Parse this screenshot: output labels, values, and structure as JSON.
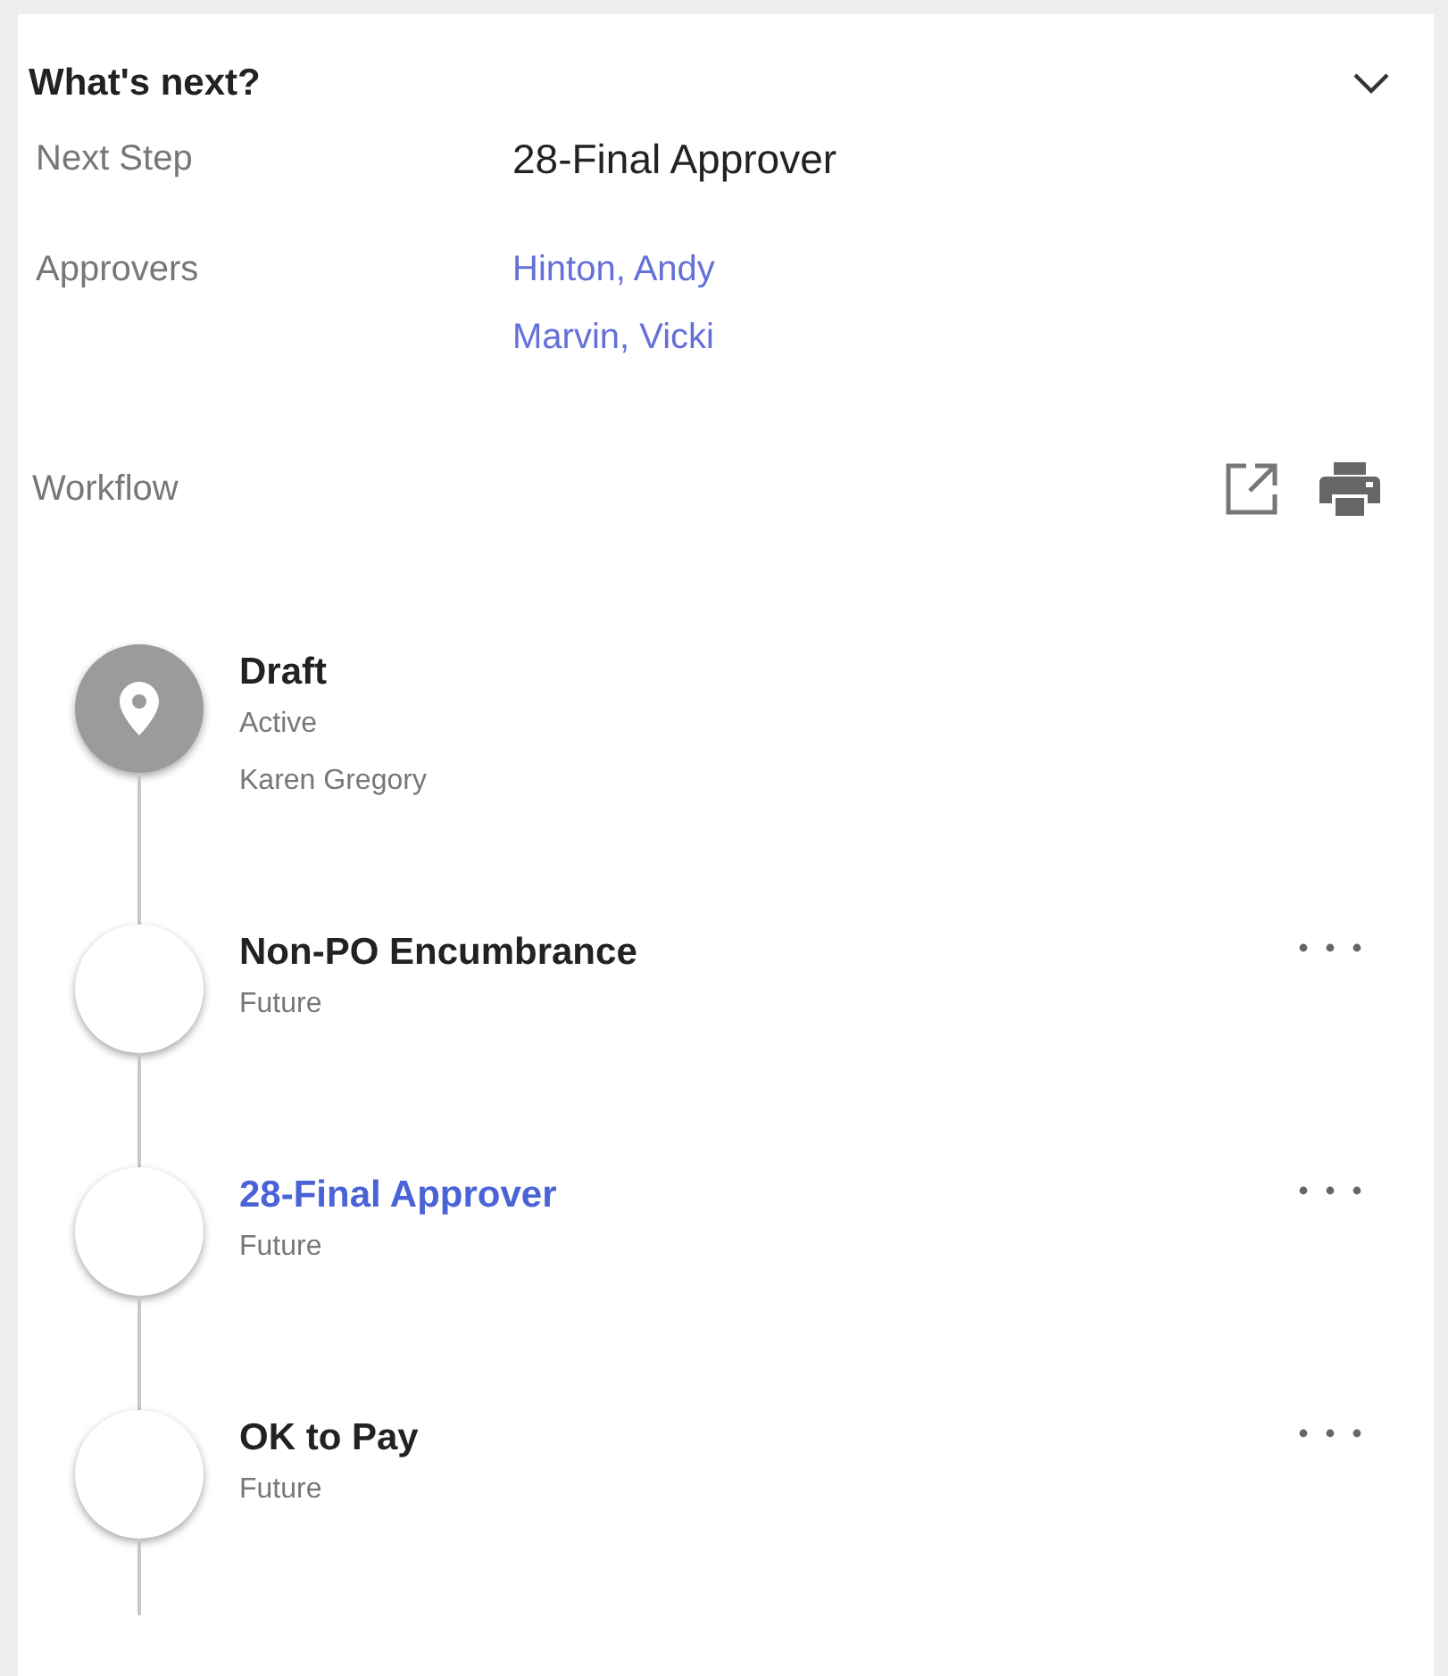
{
  "panel": {
    "title": "What's next?",
    "expanded": true
  },
  "details": [
    {
      "label": "Next Step",
      "values": [
        {
          "text": "28-Final Approver",
          "kind": "text"
        }
      ]
    },
    {
      "label": "Approvers",
      "values": [
        {
          "text": "Hinton, Andy",
          "kind": "link"
        },
        {
          "text": "Marvin, Vicki",
          "kind": "link"
        }
      ]
    }
  ],
  "workflow": {
    "label": "Workflow",
    "steps": [
      {
        "title": "Draft",
        "status": "Active",
        "assignee": "Karen Gregory",
        "kind": "active",
        "highlighted": false,
        "has_menu": false
      },
      {
        "title": "Non-PO Encumbrance",
        "status": "Future",
        "kind": "future",
        "highlighted": false,
        "has_menu": true
      },
      {
        "title": "28-Final Approver",
        "status": "Future",
        "kind": "future",
        "highlighted": true,
        "has_menu": true
      },
      {
        "title": "OK to Pay",
        "status": "Future",
        "kind": "future",
        "highlighted": false,
        "has_menu": true
      }
    ]
  }
}
